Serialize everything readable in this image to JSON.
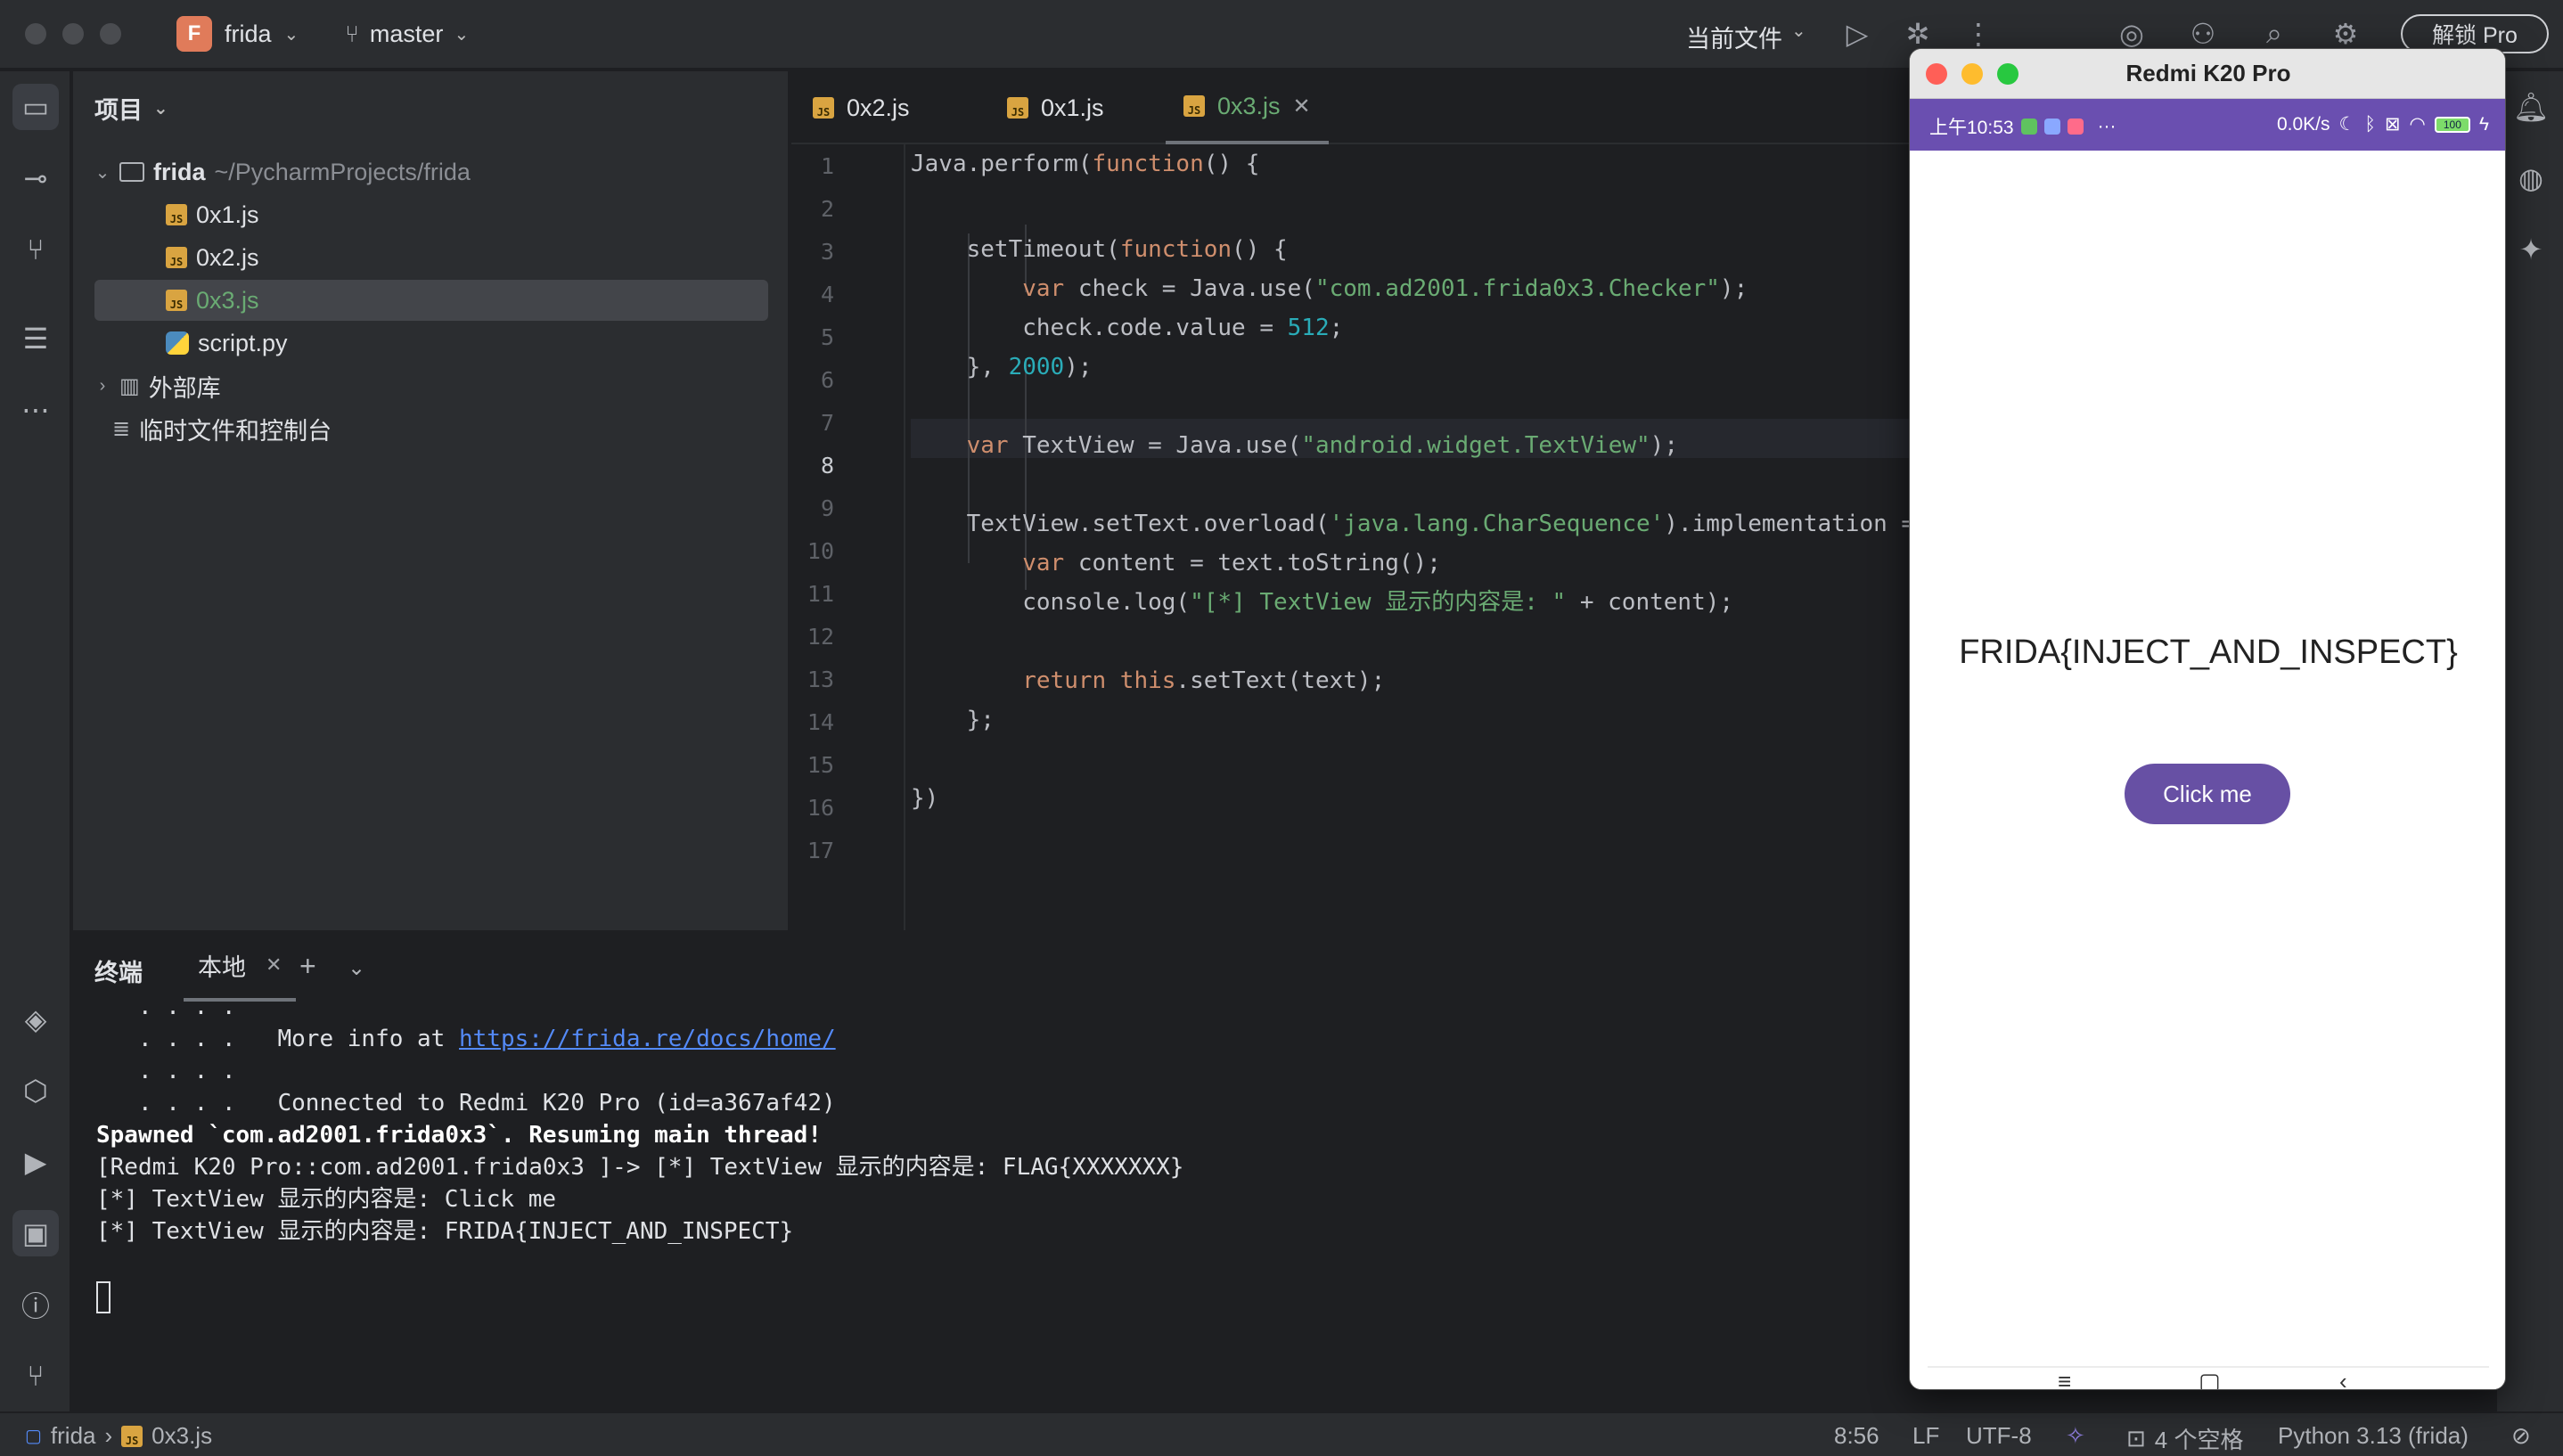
{
  "titlebar": {
    "project_letter": "F",
    "project_name": "frida",
    "branch": "master",
    "run_config": "当前文件",
    "unlock_label": "解锁 Pro"
  },
  "project_panel": {
    "title": "项目",
    "root_name": "frida",
    "root_path": "~/PycharmProjects/frida",
    "files": [
      "0x1.js",
      "0x2.js",
      "0x3.js",
      "script.py"
    ],
    "external_libs": "外部库",
    "scratches": "临时文件和控制台"
  },
  "editor": {
    "tabs": [
      "0x2.js",
      "0x1.js",
      "0x3.js"
    ],
    "active_tab": "0x3.js",
    "line_numbers": [
      "1",
      "2",
      "3",
      "4",
      "5",
      "6",
      "7",
      "8",
      "9",
      "10",
      "11",
      "12",
      "13",
      "14",
      "15",
      "16",
      "17"
    ],
    "current_line": "8"
  },
  "terminal": {
    "title": "终端",
    "tab_label": "本地",
    "lines": {
      "l0": "   . . . .",
      "l1_prefix": "   . . . .   More info at ",
      "l1_link": "https://frida.re/docs/home/",
      "l2": "   . . . .",
      "l3": "   . . . .   Connected to Redmi K20 Pro (id=a367af42)",
      "l4": "Spawned `com.ad2001.frida0x3`. Resuming main thread!",
      "l5": "[Redmi K20 Pro::com.ad2001.frida0x3 ]-> [*] TextView 显示的内容是: FLAG{XXXXXXX}",
      "l6": "[*] TextView 显示的内容是: Click me",
      "l7": "[*] TextView 显示的内容是: FRIDA{INJECT_AND_INSPECT}"
    }
  },
  "statusbar": {
    "project": "frida",
    "file": "0x3.js",
    "position": "8:56",
    "line_sep": "LF",
    "encoding": "UTF-8",
    "indent": "4 个空格",
    "interpreter": "Python 3.13 (frida)"
  },
  "emulator": {
    "title": "Redmi K20 Pro",
    "time": "上午10:53",
    "ellipsis": "···",
    "net_speed": "0.0K/s",
    "battery": "100",
    "flag_text": "FRIDA{INJECT_AND_INSPECT}",
    "button_label": "Click me"
  },
  "colors": {
    "accent_green": "#6aab73",
    "phone_status": "#6a4fb0",
    "button": "#6750a4"
  }
}
